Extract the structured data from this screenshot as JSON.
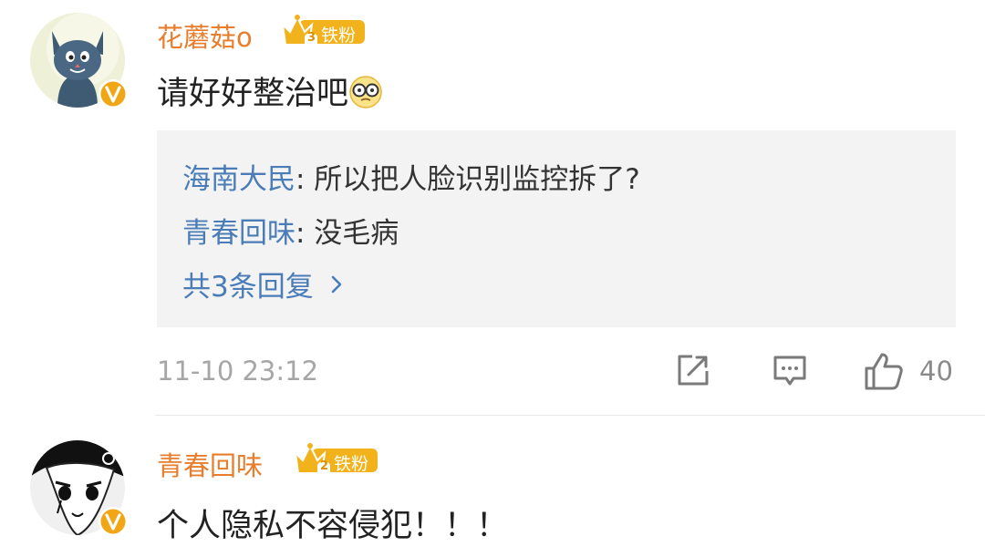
{
  "comments": [
    {
      "username": "花蘑菇o",
      "fan_badge": "铁粉",
      "fan_level": "3",
      "text": "请好好整治吧",
      "emoji": "glasses-face-emoji",
      "replies": [
        {
          "name": "海南大民",
          "text": ": 所以把人脸识别监控拆了?"
        },
        {
          "name": "青春回味",
          "text": ": 没毛病"
        }
      ],
      "more_replies": "共3条回复",
      "time": "11-10 23:12",
      "like_count": "40"
    },
    {
      "username": "青春回味",
      "fan_badge": "铁粉",
      "fan_level": "2",
      "text": "个人隐私不容侵犯！！！"
    }
  ],
  "colors": {
    "username": "#e87d2c",
    "reply_name": "#4a7cb8",
    "time": "#a6a6a6",
    "badge_gold": "#f2b21b",
    "verified": "#f1a615"
  },
  "icons": [
    "share-icon",
    "comment-icon",
    "like-icon",
    "verified-badge-icon",
    "crown-icon"
  ]
}
